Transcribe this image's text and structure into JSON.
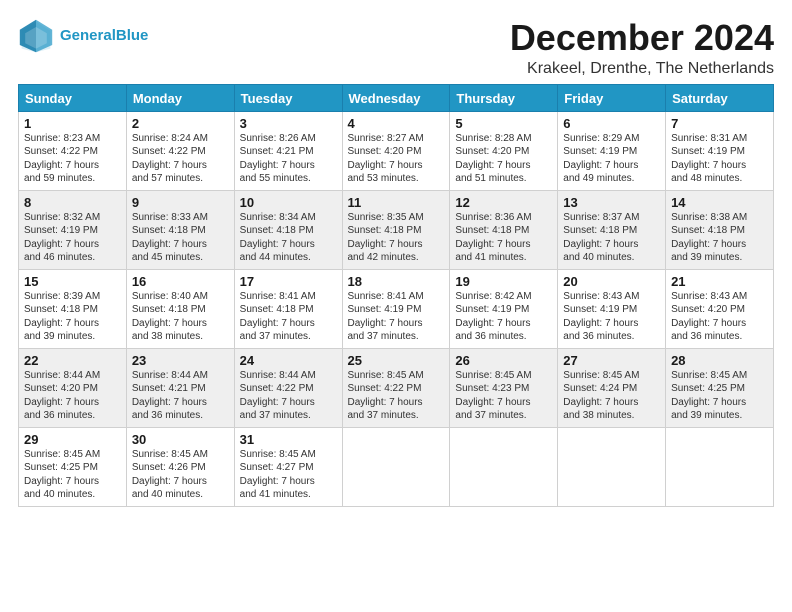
{
  "header": {
    "logo_line1": "General",
    "logo_line2": "Blue",
    "month_title": "December 2024",
    "location": "Krakeel, Drenthe, The Netherlands"
  },
  "weekdays": [
    "Sunday",
    "Monday",
    "Tuesday",
    "Wednesday",
    "Thursday",
    "Friday",
    "Saturday"
  ],
  "weeks": [
    [
      {
        "day": "1",
        "sunrise": "8:23 AM",
        "sunset": "4:22 PM",
        "daylight": "7 hours and 59 minutes."
      },
      {
        "day": "2",
        "sunrise": "8:24 AM",
        "sunset": "4:22 PM",
        "daylight": "7 hours and 57 minutes."
      },
      {
        "day": "3",
        "sunrise": "8:26 AM",
        "sunset": "4:21 PM",
        "daylight": "7 hours and 55 minutes."
      },
      {
        "day": "4",
        "sunrise": "8:27 AM",
        "sunset": "4:20 PM",
        "daylight": "7 hours and 53 minutes."
      },
      {
        "day": "5",
        "sunrise": "8:28 AM",
        "sunset": "4:20 PM",
        "daylight": "7 hours and 51 minutes."
      },
      {
        "day": "6",
        "sunrise": "8:29 AM",
        "sunset": "4:19 PM",
        "daylight": "7 hours and 49 minutes."
      },
      {
        "day": "7",
        "sunrise": "8:31 AM",
        "sunset": "4:19 PM",
        "daylight": "7 hours and 48 minutes."
      }
    ],
    [
      {
        "day": "8",
        "sunrise": "8:32 AM",
        "sunset": "4:19 PM",
        "daylight": "7 hours and 46 minutes."
      },
      {
        "day": "9",
        "sunrise": "8:33 AM",
        "sunset": "4:18 PM",
        "daylight": "7 hours and 45 minutes."
      },
      {
        "day": "10",
        "sunrise": "8:34 AM",
        "sunset": "4:18 PM",
        "daylight": "7 hours and 44 minutes."
      },
      {
        "day": "11",
        "sunrise": "8:35 AM",
        "sunset": "4:18 PM",
        "daylight": "7 hours and 42 minutes."
      },
      {
        "day": "12",
        "sunrise": "8:36 AM",
        "sunset": "4:18 PM",
        "daylight": "7 hours and 41 minutes."
      },
      {
        "day": "13",
        "sunrise": "8:37 AM",
        "sunset": "4:18 PM",
        "daylight": "7 hours and 40 minutes."
      },
      {
        "day": "14",
        "sunrise": "8:38 AM",
        "sunset": "4:18 PM",
        "daylight": "7 hours and 39 minutes."
      }
    ],
    [
      {
        "day": "15",
        "sunrise": "8:39 AM",
        "sunset": "4:18 PM",
        "daylight": "7 hours and 39 minutes."
      },
      {
        "day": "16",
        "sunrise": "8:40 AM",
        "sunset": "4:18 PM",
        "daylight": "7 hours and 38 minutes."
      },
      {
        "day": "17",
        "sunrise": "8:41 AM",
        "sunset": "4:18 PM",
        "daylight": "7 hours and 37 minutes."
      },
      {
        "day": "18",
        "sunrise": "8:41 AM",
        "sunset": "4:19 PM",
        "daylight": "7 hours and 37 minutes."
      },
      {
        "day": "19",
        "sunrise": "8:42 AM",
        "sunset": "4:19 PM",
        "daylight": "7 hours and 36 minutes."
      },
      {
        "day": "20",
        "sunrise": "8:43 AM",
        "sunset": "4:19 PM",
        "daylight": "7 hours and 36 minutes."
      },
      {
        "day": "21",
        "sunrise": "8:43 AM",
        "sunset": "4:20 PM",
        "daylight": "7 hours and 36 minutes."
      }
    ],
    [
      {
        "day": "22",
        "sunrise": "8:44 AM",
        "sunset": "4:20 PM",
        "daylight": "7 hours and 36 minutes."
      },
      {
        "day": "23",
        "sunrise": "8:44 AM",
        "sunset": "4:21 PM",
        "daylight": "7 hours and 36 minutes."
      },
      {
        "day": "24",
        "sunrise": "8:44 AM",
        "sunset": "4:22 PM",
        "daylight": "7 hours and 37 minutes."
      },
      {
        "day": "25",
        "sunrise": "8:45 AM",
        "sunset": "4:22 PM",
        "daylight": "7 hours and 37 minutes."
      },
      {
        "day": "26",
        "sunrise": "8:45 AM",
        "sunset": "4:23 PM",
        "daylight": "7 hours and 37 minutes."
      },
      {
        "day": "27",
        "sunrise": "8:45 AM",
        "sunset": "4:24 PM",
        "daylight": "7 hours and 38 minutes."
      },
      {
        "day": "28",
        "sunrise": "8:45 AM",
        "sunset": "4:25 PM",
        "daylight": "7 hours and 39 minutes."
      }
    ],
    [
      {
        "day": "29",
        "sunrise": "8:45 AM",
        "sunset": "4:25 PM",
        "daylight": "7 hours and 40 minutes."
      },
      {
        "day": "30",
        "sunrise": "8:45 AM",
        "sunset": "4:26 PM",
        "daylight": "7 hours and 40 minutes."
      },
      {
        "day": "31",
        "sunrise": "8:45 AM",
        "sunset": "4:27 PM",
        "daylight": "7 hours and 41 minutes."
      },
      null,
      null,
      null,
      null
    ]
  ]
}
